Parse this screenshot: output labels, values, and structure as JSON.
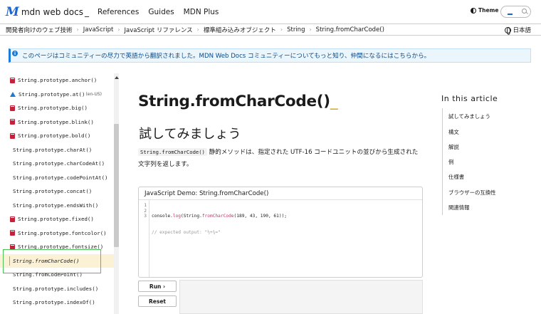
{
  "nav": {
    "logo_text": "mdn web docs",
    "logo_cursor": "_",
    "links": [
      "References",
      "Guides",
      "MDN Plus"
    ],
    "theme_label": "Theme",
    "search_placeholder": "_"
  },
  "breadcrumb": {
    "items": [
      "開発者向けのウェブ技術",
      "JavaScript",
      "JavaScript リファレンス",
      "標準組み込みオブジェクト",
      "String",
      "String.fromCharCode()"
    ],
    "separator": "›",
    "language": "日本語"
  },
  "notice": {
    "text": "このページはコミュニティーの尽力で英語から翻訳されました。MDN Web Docs コミュニティーについてもっと知り、仲間になるにはこちらから。"
  },
  "sidebar": {
    "items": [
      {
        "label": "String.prototype.anchor()",
        "icon": "deprecated-icon"
      },
      {
        "label": "String.prototype.at()",
        "icon": "experimental-icon",
        "tag": "(en-US)"
      },
      {
        "label": "String.prototype.big()",
        "icon": "deprecated-icon"
      },
      {
        "label": "String.prototype.blink()",
        "icon": "deprecated-icon"
      },
      {
        "label": "String.prototype.bold()",
        "icon": "deprecated-icon"
      },
      {
        "label": "String.prototype.charAt()",
        "icon": ""
      },
      {
        "label": "String.prototype.charCodeAt()",
        "icon": ""
      },
      {
        "label": "String.prototype.codePointAt()",
        "icon": ""
      },
      {
        "label": "String.prototype.concat()",
        "icon": ""
      },
      {
        "label": "String.prototype.endsWith()",
        "icon": ""
      },
      {
        "label": "String.prototype.fixed()",
        "icon": "deprecated-icon"
      },
      {
        "label": "String.prototype.fontcolor()",
        "icon": "deprecated-icon"
      },
      {
        "label": "String.prototype.fontsize()",
        "icon": "deprecated-icon"
      },
      {
        "label": "String.fromCharCode()",
        "icon": "",
        "active": true
      },
      {
        "label": "String.fromCodePoint()",
        "icon": ""
      },
      {
        "label": "String.prototype.includes()",
        "icon": ""
      },
      {
        "label": "String.prototype.indexOf()",
        "icon": ""
      }
    ]
  },
  "main": {
    "title": "String.fromCharCode()",
    "title_cursor": "_",
    "section_heading": "試してみましょう",
    "desc_code": "String.fromCharCode()",
    "desc_line1": " 静的メソッドは、指定された UTF-16 コードユニットの並びから生成された",
    "desc_line2": "文字列を返します。",
    "demo_title": "JavaScript Demo: String.fromCharCode()",
    "code_lines": [
      "1",
      "2",
      "3"
    ],
    "code_l1_a": "console.",
    "code_l1_b": "log",
    "code_l1_c": "(String.",
    "code_l1_d": "fromCharCode",
    "code_l1_e": "(189, 43, 190, 61));",
    "code_l2": "// expected output: \"½+¾=\"",
    "run_label": "Run ›",
    "reset_label": "Reset"
  },
  "toc": {
    "title": "In this article",
    "items": [
      "試してみましょう",
      "構文",
      "解説",
      "例",
      "仕様書",
      "ブラウザーの互換性",
      "関連情報"
    ]
  }
}
